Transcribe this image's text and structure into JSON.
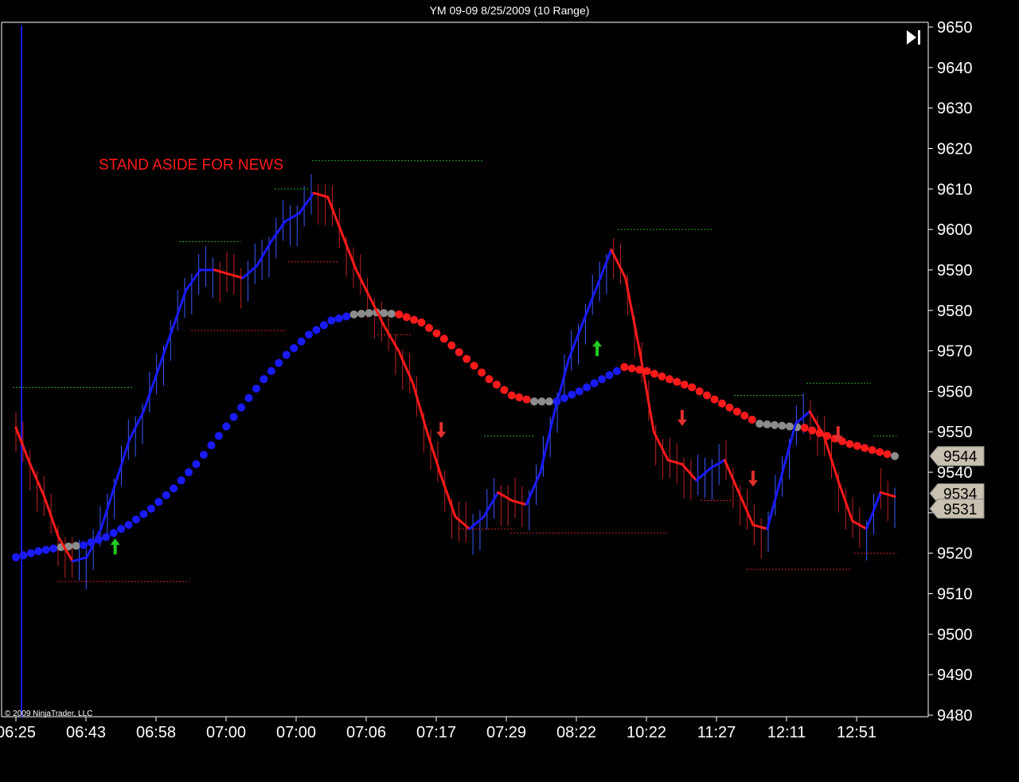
{
  "window": {
    "title": "YM 09-09  8/25/2009 (10 Range)"
  },
  "copyright": "© 2009 NinjaTrader, LLC",
  "colors": {
    "background": "#000000",
    "up_line": "#1a1aff",
    "down_line": "#ff1a1a",
    "neutral": "#8c8c8c",
    "up_arrow": "#22cc22",
    "down_arrow": "#e03030",
    "support": "#cc2222",
    "resistance": "#22aa22",
    "price_tag": "#c8c0b0"
  },
  "chart_data": {
    "type": "line",
    "instrument": "YM 09-09",
    "date": "8/25/2009",
    "bar_type": "10 Range",
    "ylim": [
      9480,
      9650
    ],
    "y_ticks": [
      9650,
      9640,
      9630,
      9620,
      9610,
      9600,
      9590,
      9580,
      9570,
      9560,
      9550,
      9540,
      9530,
      9520,
      9510,
      9500,
      9490,
      9480
    ],
    "x_tick_labels": [
      "06:25",
      "06:43",
      "06:58",
      "07:00",
      "07:00",
      "07:06",
      "07:17",
      "07:29",
      "08:22",
      "10:22",
      "11:27",
      "12:11",
      "12:51"
    ],
    "annotations": [
      {
        "text": "STAND ASIDE FOR NEWS"
      }
    ],
    "price_tags": [
      9544,
      9534,
      9531
    ],
    "series": [
      {
        "style": "line",
        "values": [
          9551,
          9542,
          9534,
          9524,
          9518,
          9519,
          9526,
          9537,
          9548,
          9555,
          9565,
          9575,
          9585,
          9590,
          9590,
          9589,
          9588,
          9591,
          9597,
          9602,
          9604,
          9609,
          9608,
          9599,
          9590,
          9583,
          9576,
          9570,
          9562,
          9550,
          9539,
          9529,
          9526,
          9529,
          9535,
          9533,
          9532,
          9540,
          9555,
          9568,
          9577,
          9586,
          9595,
          9588,
          9570,
          9550,
          9543,
          9542,
          9538,
          9541,
          9543,
          9535,
          9527,
          9526,
          9539,
          9552,
          9555,
          9549,
          9538,
          9528,
          9526,
          9535,
          9534
        ]
      },
      {
        "style": "dots",
        "values": [
          9519,
          9520.5,
          9521.5,
          9522,
          9524,
          9527,
          9531,
          9536,
          9542,
          9549,
          9556,
          9563,
          9569,
          9574,
          9577.5,
          9579,
          9579.5,
          9579,
          9577,
          9573,
          9568,
          9563,
          9559,
          9557.5,
          9557.5,
          9560,
          9563,
          9566,
          9565,
          9563,
          9561,
          9558,
          9555,
          9552,
          9551.5,
          9551,
          9549,
          9547,
          9545.5,
          9544
        ]
      }
    ],
    "signals": [
      {
        "type": "buy",
        "bar": 7
      },
      {
        "type": "sell",
        "bar": 30
      },
      {
        "type": "buy",
        "bar": 41
      },
      {
        "type": "sell",
        "bar": 47
      },
      {
        "type": "sell",
        "bar": 52
      },
      {
        "type": "sell",
        "bar": 58
      }
    ]
  }
}
